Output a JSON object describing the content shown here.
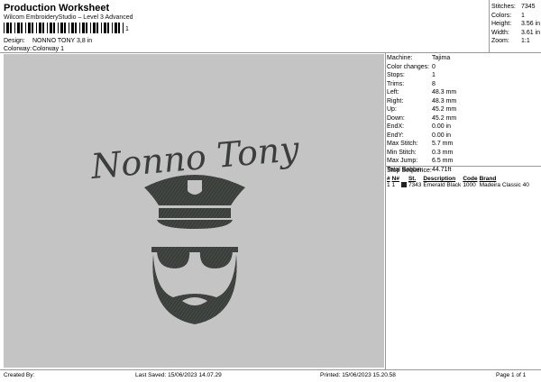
{
  "header": {
    "title": "Production Worksheet",
    "subtitle": "Wilcom EmbroideryStudio – Level 3 Advanced",
    "barcode_suffix": "1"
  },
  "meta": [
    {
      "label": "Design:",
      "value": "NONNO TONY 3,8 in"
    },
    {
      "label": "Colorway:",
      "value": "Colorway 1"
    }
  ],
  "stats": [
    {
      "label": "Stitches:",
      "value": "7345"
    },
    {
      "label": "Colors:",
      "value": "1"
    },
    {
      "label": "Height:",
      "value": "3.56 in"
    },
    {
      "label": "Width:",
      "value": "3.61 in"
    },
    {
      "label": "Zoom:",
      "value": "1:1"
    }
  ],
  "design": {
    "text": "Nonno Tony",
    "thread_color": "#3b3f3b",
    "canvas_color": "#c4c4c4"
  },
  "machine": [
    {
      "label": "Machine:",
      "value": "Tajima"
    },
    {
      "label": "Color changes:",
      "value": "0"
    },
    {
      "label": "Stops:",
      "value": "1"
    },
    {
      "label": "Trims:",
      "value": "8"
    },
    {
      "label": "Left:",
      "value": "48.3 mm"
    },
    {
      "label": "Right:",
      "value": "48.3 mm"
    },
    {
      "label": "Up:",
      "value": "45.2 mm"
    },
    {
      "label": "Down:",
      "value": "45.2 mm"
    },
    {
      "label": "EndX:",
      "value": "0.00 in"
    },
    {
      "label": "EndY:",
      "value": "0.00 in"
    },
    {
      "label": "Max Stitch:",
      "value": "5.7 mm"
    },
    {
      "label": "Min Stitch:",
      "value": "0.3 mm"
    },
    {
      "label": "Max Jump:",
      "value": "6.5 mm"
    },
    {
      "label": "Total Bobbin:",
      "value": "44.71ft"
    }
  ],
  "stop_sequence": {
    "title": "Stop Sequence:",
    "columns": [
      "#",
      "N#",
      "St.",
      "Description",
      "Code",
      "Brand"
    ],
    "rows": [
      {
        "num": "1",
        "n": "1",
        "st": "7343",
        "desc": "Emerald Black",
        "code": "1000",
        "brand": "Madeira Classic 40",
        "color": "#222222"
      }
    ]
  },
  "footer": {
    "created": "Created By:",
    "saved": "Last Saved: 15/06/2023 14.07.29",
    "printed": "Printed: 15/06/2023 15.20.58",
    "page": "Page 1 of 1"
  }
}
